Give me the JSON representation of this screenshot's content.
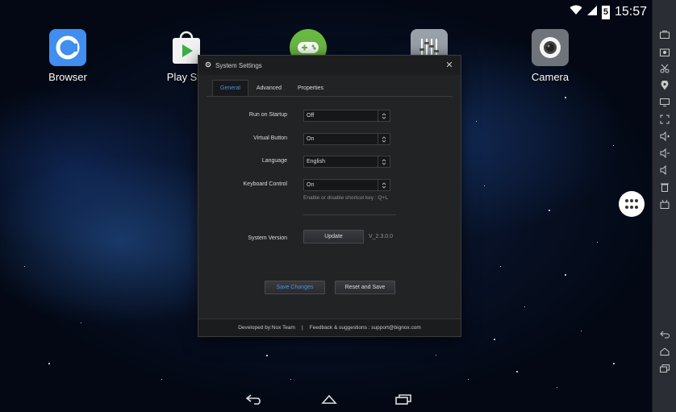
{
  "status_bar": {
    "battery": "5",
    "clock": "15:57"
  },
  "desktop": {
    "apps": [
      {
        "label": "Browser"
      },
      {
        "label": "Play Sto"
      },
      {
        "label": ""
      },
      {
        "label": ""
      },
      {
        "label": "Camera"
      }
    ]
  },
  "dialog": {
    "title": "System Settings",
    "close": "✕",
    "tabs": [
      "General",
      "Advanced",
      "Properties"
    ],
    "rows": [
      {
        "label": "Run on Startup",
        "value": "Off"
      },
      {
        "label": "Virtual Button",
        "value": "On"
      },
      {
        "label": "Language",
        "value": "English"
      },
      {
        "label": "Keyboard Control",
        "value": "On"
      }
    ],
    "keyboard_hint": "Enable or disable shortcut key : Q+L",
    "system_version_label": "System Version",
    "update_label": "Update",
    "version": "V_2.3.0.0",
    "save_label": "Save Changes",
    "reset_label": "Reset and Save",
    "footer": {
      "developed_by": "Developed by:Nox Team",
      "separator": "|",
      "feedback": "Feedback & suggestions : support@bignox.com"
    }
  },
  "colors": {
    "accent": "#4e8fe0",
    "dialog_bg": "#222325",
    "sidebar_bg": "#2a2d33"
  }
}
